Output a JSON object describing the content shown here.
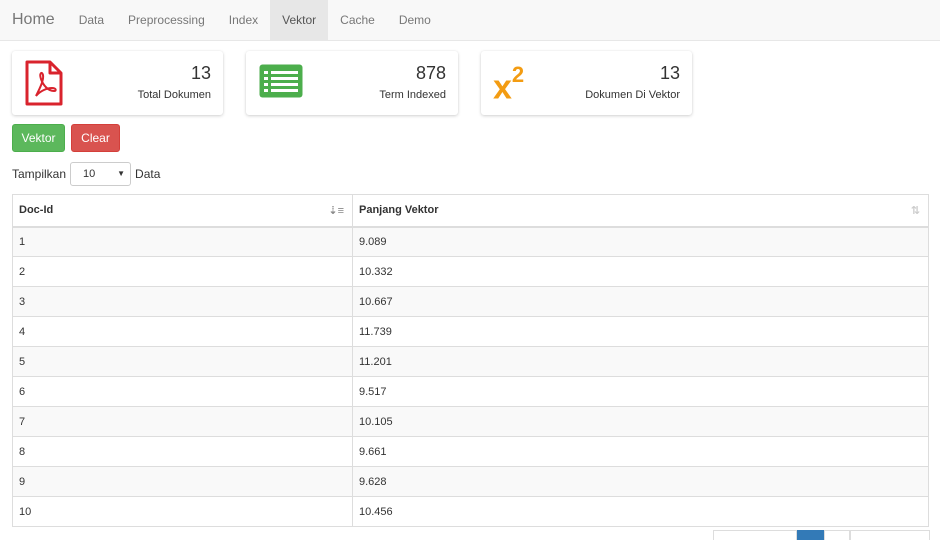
{
  "nav": {
    "brand": "Home",
    "items": [
      {
        "label": "Data",
        "active": false
      },
      {
        "label": "Preprocessing",
        "active": false
      },
      {
        "label": "Index",
        "active": false
      },
      {
        "label": "Vektor",
        "active": true
      },
      {
        "label": "Cache",
        "active": false
      },
      {
        "label": "Demo",
        "active": false
      }
    ]
  },
  "cards": [
    {
      "icon": "pdf-icon",
      "value": "13",
      "label": "Total Dokumen",
      "color": "#d9232d"
    },
    {
      "icon": "list-icon",
      "value": "878",
      "label": "Term Indexed",
      "color": "#4cae4c"
    },
    {
      "icon": "x-squared-icon",
      "value": "13",
      "label": "Dokumen Di Vektor",
      "color": "#f39c12"
    }
  ],
  "buttons": {
    "vektor": "Vektor",
    "clear": "Clear"
  },
  "length": {
    "prefix": "Tampilkan",
    "value": "10",
    "suffix": "Data"
  },
  "table": {
    "columns": [
      "Doc-Id",
      "Panjang Vektor"
    ],
    "rows": [
      [
        "1",
        "9.089"
      ],
      [
        "2",
        "10.332"
      ],
      [
        "3",
        "10.667"
      ],
      [
        "4",
        "11.739"
      ],
      [
        "5",
        "11.201"
      ],
      [
        "6",
        "9.517"
      ],
      [
        "7",
        "10.105"
      ],
      [
        "8",
        "9.661"
      ],
      [
        "9",
        "9.628"
      ],
      [
        "10",
        "10.456"
      ]
    ]
  },
  "colors": {
    "success": "#5cb85c",
    "danger": "#d9534f",
    "pdf": "#d9232d",
    "list": "#4cae4c",
    "x2": "#f39c12"
  }
}
